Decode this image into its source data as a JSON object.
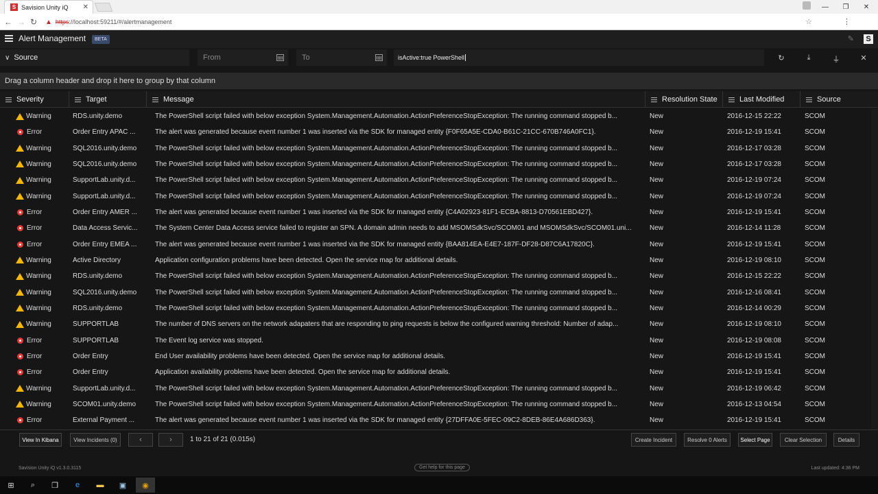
{
  "browser": {
    "tab_title": "Savision Unity iQ",
    "tab_favicon": "S",
    "url_https": "https",
    "url_rest": "://localhost:59211/#/alertmanagement"
  },
  "header": {
    "title": "Alert Management",
    "badge": "BETA",
    "logo": "S"
  },
  "filters": {
    "source_label": "Source",
    "from_placeholder": "From",
    "to_placeholder": "To",
    "query": "isActive:true PowerShell"
  },
  "group_bar": "Drag a column header and drop it here to group by that column",
  "columns": {
    "severity": "Severity",
    "target": "Target",
    "message": "Message",
    "resolution": "Resolution State",
    "modified": "Last Modified",
    "source": "Source"
  },
  "rows": [
    {
      "severity": "Warning",
      "target": "RDS.unity.demo",
      "message": "The PowerShell script failed with below exception System.Management.Automation.ActionPreferenceStopException: The running command stopped b...",
      "resolution": "New",
      "modified": "2016-12-15 22:22",
      "source": "SCOM"
    },
    {
      "severity": "Error",
      "target": "Order Entry APAC ...",
      "message": "The alert was generated because event number 1 was inserted via the SDK for managed entity {F0F65A5E-CDA0-B61C-21CC-670B746A0FC1}.",
      "resolution": "New",
      "modified": "2016-12-19 15:41",
      "source": "SCOM"
    },
    {
      "severity": "Warning",
      "target": "SQL2016.unity.demo",
      "message": "The PowerShell script failed with below exception System.Management.Automation.ActionPreferenceStopException: The running command stopped b...",
      "resolution": "New",
      "modified": "2016-12-17 03:28",
      "source": "SCOM"
    },
    {
      "severity": "Warning",
      "target": "SQL2016.unity.demo",
      "message": "The PowerShell script failed with below exception System.Management.Automation.ActionPreferenceStopException: The running command stopped b...",
      "resolution": "New",
      "modified": "2016-12-17 03:28",
      "source": "SCOM"
    },
    {
      "severity": "Warning",
      "target": "SupportLab.unity.d...",
      "message": "The PowerShell script failed with below exception System.Management.Automation.ActionPreferenceStopException: The running command stopped b...",
      "resolution": "New",
      "modified": "2016-12-19 07:24",
      "source": "SCOM"
    },
    {
      "severity": "Warning",
      "target": "SupportLab.unity.d...",
      "message": "The PowerShell script failed with below exception System.Management.Automation.ActionPreferenceStopException: The running command stopped b...",
      "resolution": "New",
      "modified": "2016-12-19 07:24",
      "source": "SCOM"
    },
    {
      "severity": "Error",
      "target": "Order Entry AMER ...",
      "message": "The alert was generated because event number 1 was inserted via the SDK for managed entity {C4A02923-81F1-ECBA-8813-D70561EBD427}.",
      "resolution": "New",
      "modified": "2016-12-19 15:41",
      "source": "SCOM"
    },
    {
      "severity": "Error",
      "target": "Data Access Servic...",
      "message": "The System Center Data Access service failed to register an SPN. A domain admin needs to add MSOMSdkSvc/SCOM01 and MSOMSdkSvc/SCOM01.uni...",
      "resolution": "New",
      "modified": "2016-12-14 11:28",
      "source": "SCOM"
    },
    {
      "severity": "Error",
      "target": "Order Entry EMEA ...",
      "message": "The alert was generated because event number 1 was inserted via the SDK for managed entity {BAA814EA-E4E7-187F-DF28-D87C6A17820C}.",
      "resolution": "New",
      "modified": "2016-12-19 15:41",
      "source": "SCOM"
    },
    {
      "severity": "Warning",
      "target": "Active Directory",
      "message": "Application configuration problems have been detected. Open the service map for additional details.",
      "resolution": "New",
      "modified": "2016-12-19 08:10",
      "source": "SCOM"
    },
    {
      "severity": "Warning",
      "target": "RDS.unity.demo",
      "message": "The PowerShell script failed with below exception System.Management.Automation.ActionPreferenceStopException: The running command stopped b...",
      "resolution": "New",
      "modified": "2016-12-15 22:22",
      "source": "SCOM"
    },
    {
      "severity": "Warning",
      "target": "SQL2016.unity.demo",
      "message": "The PowerShell script failed with below exception System.Management.Automation.ActionPreferenceStopException: The running command stopped b...",
      "resolution": "New",
      "modified": "2016-12-16 08:41",
      "source": "SCOM"
    },
    {
      "severity": "Warning",
      "target": "RDS.unity.demo",
      "message": "The PowerShell script failed with below exception System.Management.Automation.ActionPreferenceStopException: The running command stopped b...",
      "resolution": "New",
      "modified": "2016-12-14 00:29",
      "source": "SCOM"
    },
    {
      "severity": "Warning",
      "target": "SUPPORTLAB",
      "message": "The number of DNS servers on the network adapaters that are responding to ping requests is below the configured warning threshold: Number of adap...",
      "resolution": "New",
      "modified": "2016-12-19 08:10",
      "source": "SCOM"
    },
    {
      "severity": "Error",
      "target": "SUPPORTLAB",
      "message": "The Event log service was stopped.",
      "resolution": "New",
      "modified": "2016-12-19 08:08",
      "source": "SCOM"
    },
    {
      "severity": "Error",
      "target": "Order Entry",
      "message": "End User availability problems have been detected. Open the service map for additional details.",
      "resolution": "New",
      "modified": "2016-12-19 15:41",
      "source": "SCOM"
    },
    {
      "severity": "Error",
      "target": "Order Entry",
      "message": "Application availability problems have been detected. Open the service map for additional details.",
      "resolution": "New",
      "modified": "2016-12-19 15:41",
      "source": "SCOM"
    },
    {
      "severity": "Warning",
      "target": "SupportLab.unity.d...",
      "message": "The PowerShell script failed with below exception System.Management.Automation.ActionPreferenceStopException: The running command stopped b...",
      "resolution": "New",
      "modified": "2016-12-19 06:42",
      "source": "SCOM"
    },
    {
      "severity": "Warning",
      "target": "SCOM01.unity.demo",
      "message": "The PowerShell script failed with below exception System.Management.Automation.ActionPreferenceStopException: The running command stopped b...",
      "resolution": "New",
      "modified": "2016-12-13 04:54",
      "source": "SCOM"
    },
    {
      "severity": "Error",
      "target": "External Payment ...",
      "message": "The alert was generated because event number 1 was inserted via the SDK for managed entity {27DFFA0E-5FEC-09C2-8DEB-86E4A686D363}.",
      "resolution": "New",
      "modified": "2016-12-19 15:41",
      "source": "SCOM"
    }
  ],
  "footer": {
    "view_kibana": "View In Kibana",
    "view_incidents": "View Incidents (0)",
    "pager_text": "1 to 21 of 21 (0.015s)",
    "create_incident": "Create Incident",
    "resolve_alerts": "Resolve 0 Alerts",
    "select_page": "Select Page",
    "clear_selection": "Clear Selection",
    "details": "Details"
  },
  "status": {
    "version": "Savision Unity iQ v1.3.0.3115",
    "help": "Get help for this page",
    "updated": "Last updated: 4:36 PM"
  },
  "colors": {
    "warning": "#f5b700",
    "error": "#e53935"
  }
}
